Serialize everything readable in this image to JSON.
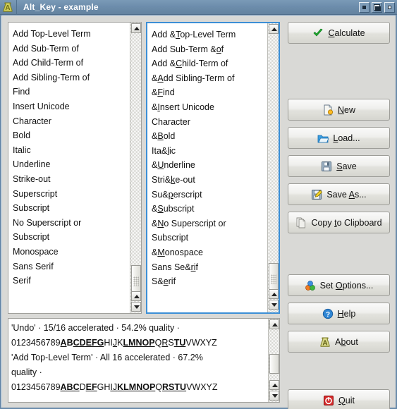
{
  "window": {
    "title": "Alt_Key - example",
    "icon": "flask-a-icon",
    "controls": [
      {
        "name": "minimize-button",
        "glyph": "minimize"
      },
      {
        "name": "maximize-button",
        "glyph": "maximize"
      },
      {
        "name": "close-button",
        "glyph": "close"
      }
    ]
  },
  "left_list": {
    "name": "source-terms-list",
    "items": [
      "Add Top-Level Term",
      "Add Sub-Term of",
      "Add Child-Term of",
      "Add Sibling-Term of",
      "Find",
      "Insert Unicode",
      "Character",
      "Bold",
      "Italic",
      "Underline",
      "Strike-out",
      "Superscript",
      "Subscript",
      "No Superscript or",
      "Subscript",
      "Monospace",
      "Sans Serif",
      "Serif"
    ]
  },
  "right_list": {
    "name": "accelerated-terms-list",
    "items": [
      {
        "pre": "Add &",
        "acc": "T",
        "post": "op-Level Term"
      },
      {
        "pre": "Add Sub-Term &",
        "acc": "o",
        "post": "f"
      },
      {
        "pre": "Add &",
        "acc": "C",
        "post": "hild-Term of"
      },
      {
        "pre": "&",
        "acc": "A",
        "post": "dd Sibling-Term of"
      },
      {
        "pre": "&",
        "acc": "F",
        "post": "ind"
      },
      {
        "pre": "&",
        "acc": "I",
        "post": "nsert Unicode"
      },
      {
        "pre": "Character",
        "acc": "",
        "post": ""
      },
      {
        "pre": "&",
        "acc": "B",
        "post": "old"
      },
      {
        "pre": "Ita&",
        "acc": "l",
        "post": "ic"
      },
      {
        "pre": "&",
        "acc": "U",
        "post": "nderline"
      },
      {
        "pre": "Stri&",
        "acc": "k",
        "post": "e-out"
      },
      {
        "pre": "Su&",
        "acc": "p",
        "post": "erscript"
      },
      {
        "pre": "&",
        "acc": "S",
        "post": "ubscript"
      },
      {
        "pre": "&",
        "acc": "N",
        "post": "o Superscript or"
      },
      {
        "pre": "Subscript",
        "acc": "",
        "post": ""
      },
      {
        "pre": "&",
        "acc": "M",
        "post": "onospace"
      },
      {
        "pre": "Sans Se&",
        "acc": "ri",
        "post": "f"
      },
      {
        "pre": "S&",
        "acc": "e",
        "post": "rif"
      }
    ]
  },
  "buttons": [
    {
      "name": "calculate-button",
      "icon": "green-check-icon",
      "pre": "",
      "acc": "C",
      "post": "alculate"
    },
    {
      "name": "new-button",
      "icon": "new-document-icon",
      "pre": "",
      "acc": "N",
      "post": "ew"
    },
    {
      "name": "load-button",
      "icon": "open-folder-icon",
      "pre": "",
      "acc": "L",
      "post": "oad..."
    },
    {
      "name": "save-button",
      "icon": "floppy-disk-icon",
      "pre": "",
      "acc": "S",
      "post": "ave"
    },
    {
      "name": "save-as-button",
      "icon": "floppy-pencil-icon",
      "pre": "Save ",
      "acc": "A",
      "post": "s..."
    },
    {
      "name": "copy-to-clipboard-button",
      "icon": "copy-pages-icon",
      "pre": "Copy ",
      "acc": "t",
      "post": "o Clipboard"
    },
    {
      "name": "set-options-button",
      "icon": "colored-spheres-icon",
      "pre": "Set ",
      "acc": "O",
      "post": "ptions..."
    },
    {
      "name": "help-button",
      "icon": "blue-question-icon",
      "pre": "",
      "acc": "H",
      "post": "elp"
    },
    {
      "name": "about-button",
      "icon": "flask-a-icon",
      "pre": "A",
      "acc": "b",
      "post": "out"
    },
    {
      "name": "quit-button",
      "icon": "red-power-icon",
      "pre": "",
      "acc": "Q",
      "post": "uit"
    }
  ],
  "results": {
    "name": "results-text-area",
    "lines": [
      [
        {
          "t": "'Undo' · 15/16 accelerated · 54.2% quality ·",
          "b": false,
          "u": false
        }
      ],
      [
        {
          "t": "0123456789",
          "b": false,
          "u": false
        },
        {
          "t": "A",
          "b": true,
          "u": true
        },
        {
          "t": "B",
          "b": true,
          "u": false
        },
        {
          "t": "CDEFG",
          "b": true,
          "u": true
        },
        {
          "t": "HI",
          "b": false,
          "u": false
        },
        {
          "t": "J",
          "b": false,
          "u": true
        },
        {
          "t": "K",
          "b": false,
          "u": false
        },
        {
          "t": "LMNOP",
          "b": true,
          "u": true
        },
        {
          "t": "Q",
          "b": false,
          "u": false
        },
        {
          "t": "R",
          "b": false,
          "u": true
        },
        {
          "t": "S",
          "b": false,
          "u": false
        },
        {
          "t": "TU",
          "b": true,
          "u": true
        },
        {
          "t": "VWXYZ",
          "b": false,
          "u": false
        }
      ],
      [
        {
          "t": "'Add Top-Level Term' · All 16 accelerated · 67.2%",
          "b": false,
          "u": false
        }
      ],
      [
        {
          "t": "quality ·",
          "b": false,
          "u": false
        }
      ],
      [
        {
          "t": "0123456789",
          "b": false,
          "u": false
        },
        {
          "t": "ABC",
          "b": true,
          "u": true
        },
        {
          "t": "D",
          "b": false,
          "u": false
        },
        {
          "t": "EF",
          "b": true,
          "u": true
        },
        {
          "t": "GH",
          "b": false,
          "u": false
        },
        {
          "t": "IJ",
          "b": false,
          "u": true
        },
        {
          "t": "KLMNOP",
          "b": true,
          "u": true
        },
        {
          "t": "Q",
          "b": false,
          "u": false
        },
        {
          "t": "RSTU",
          "b": true,
          "u": true
        },
        {
          "t": "VWXYZ",
          "b": false,
          "u": false
        }
      ]
    ]
  },
  "colors": {
    "titlebar": "#6c8cab",
    "window_bg": "#d9d9d6",
    "focus_border": "#3c8fd6",
    "text": "#111111"
  }
}
